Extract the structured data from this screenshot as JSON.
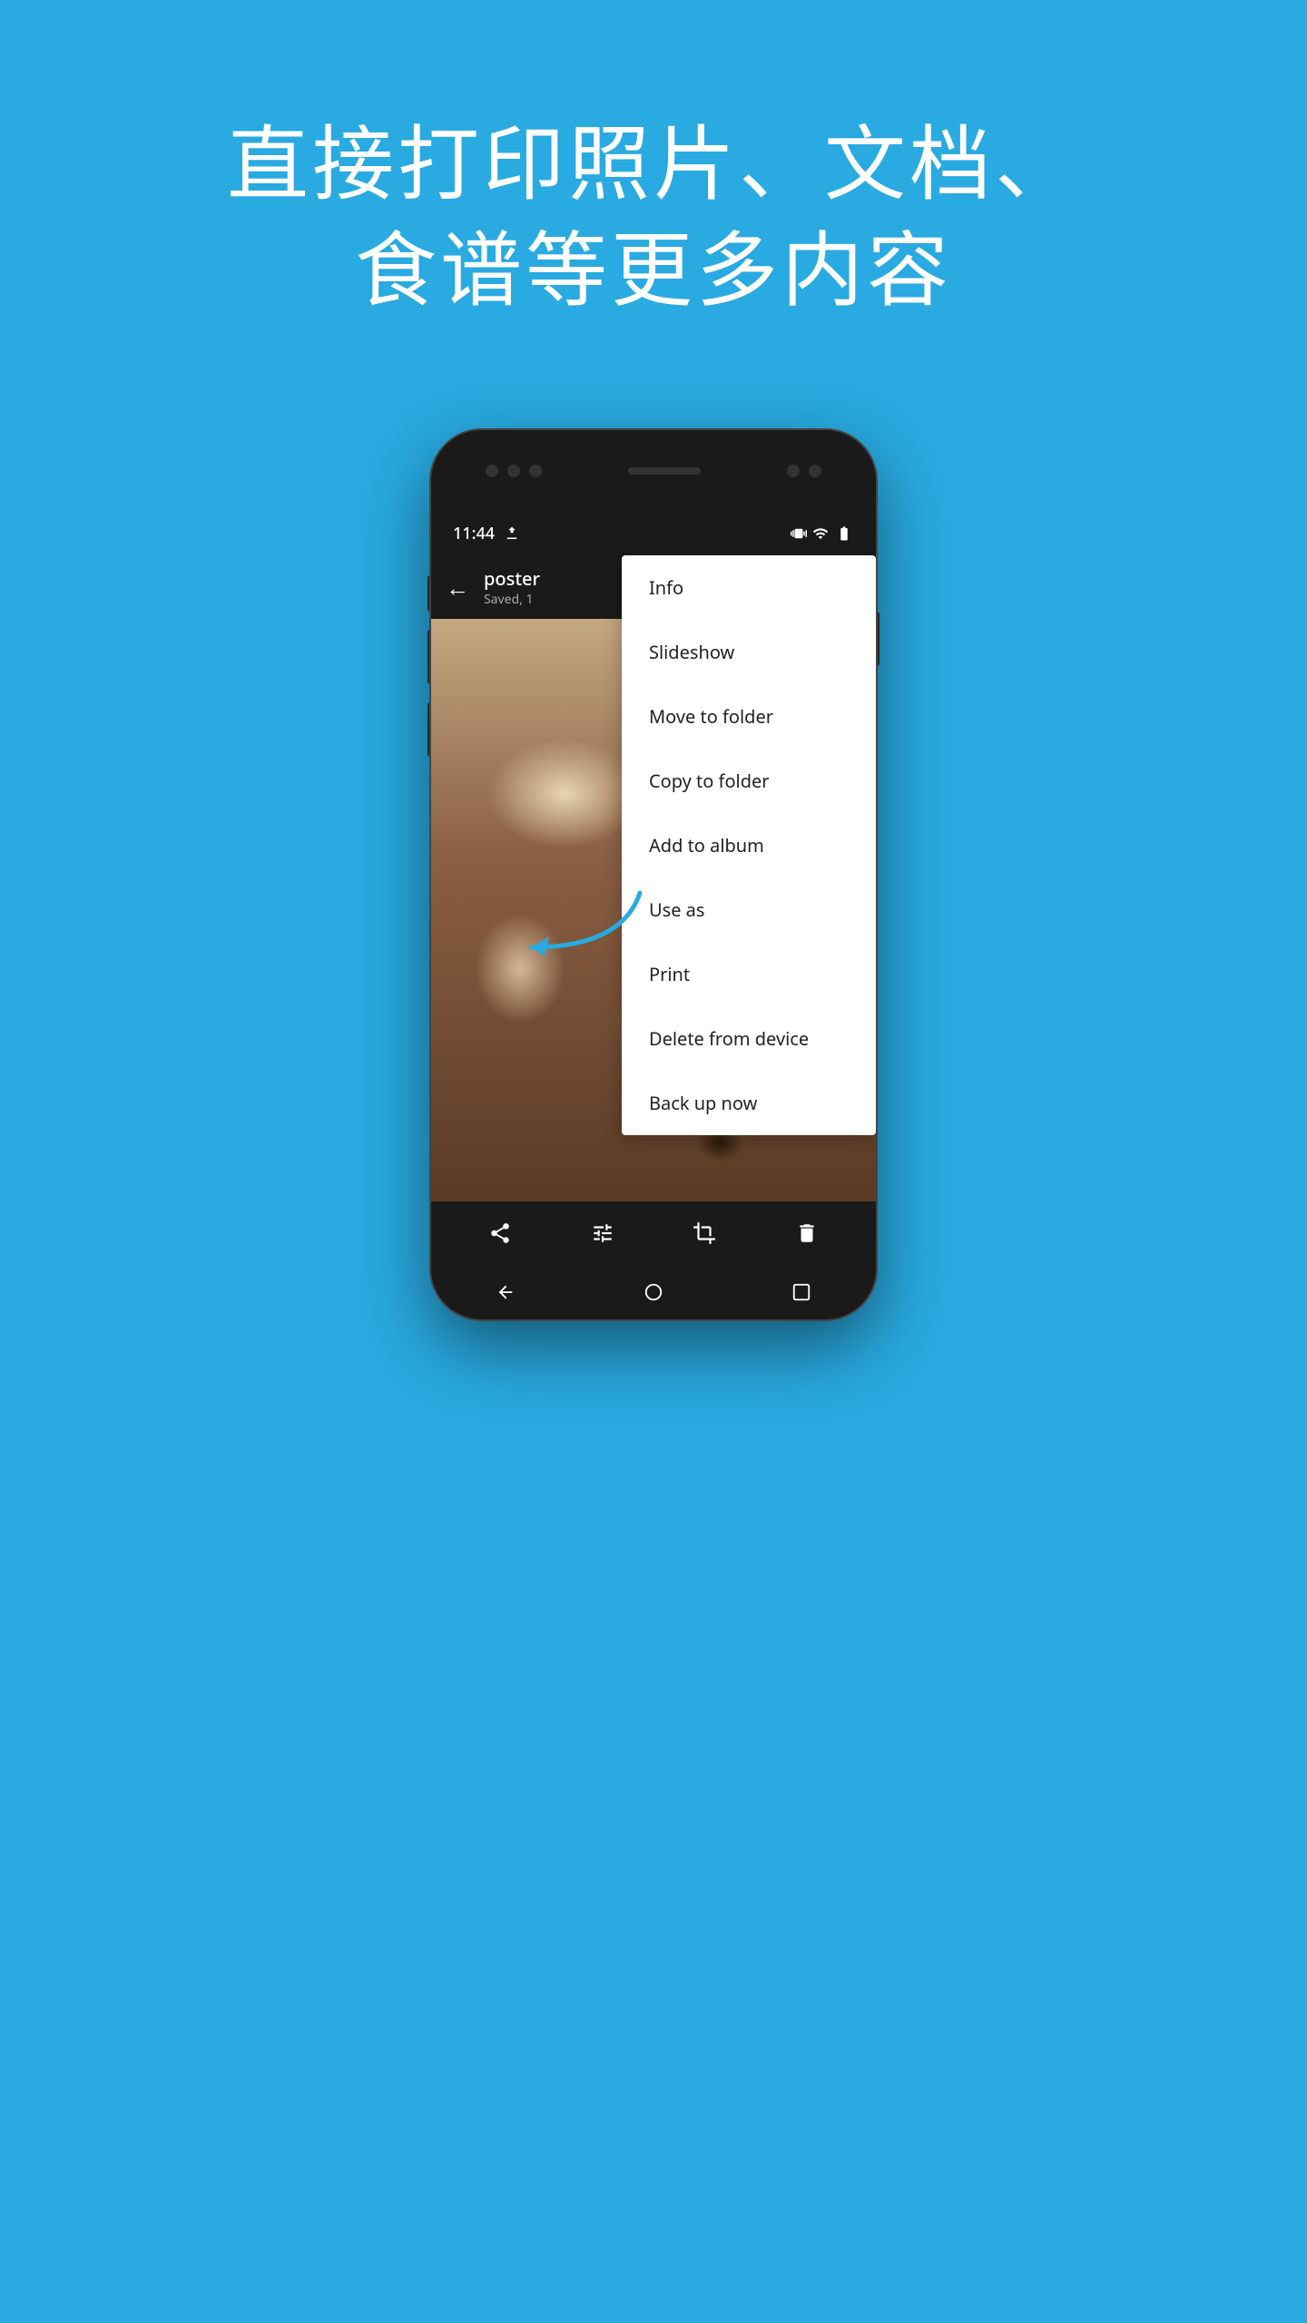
{
  "page": {
    "background_color": "#29AAE1",
    "header": {
      "line1": "直接打印照片、文档、",
      "line2": "食谱等更多内容"
    },
    "phone": {
      "status_bar": {
        "time": "11:44"
      },
      "app_bar": {
        "title": "poster",
        "subtitle": "Saved, 1"
      },
      "menu": {
        "items": [
          {
            "id": "info",
            "label": "Info"
          },
          {
            "id": "slideshow",
            "label": "Slideshow"
          },
          {
            "id": "move-to-folder",
            "label": "Move to folder"
          },
          {
            "id": "copy-to-folder",
            "label": "Copy to folder"
          },
          {
            "id": "add-to-album",
            "label": "Add to album"
          },
          {
            "id": "use-as",
            "label": "Use as"
          },
          {
            "id": "print",
            "label": "Print"
          },
          {
            "id": "delete-from-device",
            "label": "Delete from device"
          },
          {
            "id": "back-up-now",
            "label": "Back up now"
          }
        ]
      },
      "toolbar": {
        "share_label": "share",
        "adjust_label": "adjust",
        "edit_label": "edit",
        "delete_label": "delete"
      },
      "nav": {
        "back_label": "back",
        "home_label": "home",
        "recents_label": "recents"
      }
    }
  }
}
